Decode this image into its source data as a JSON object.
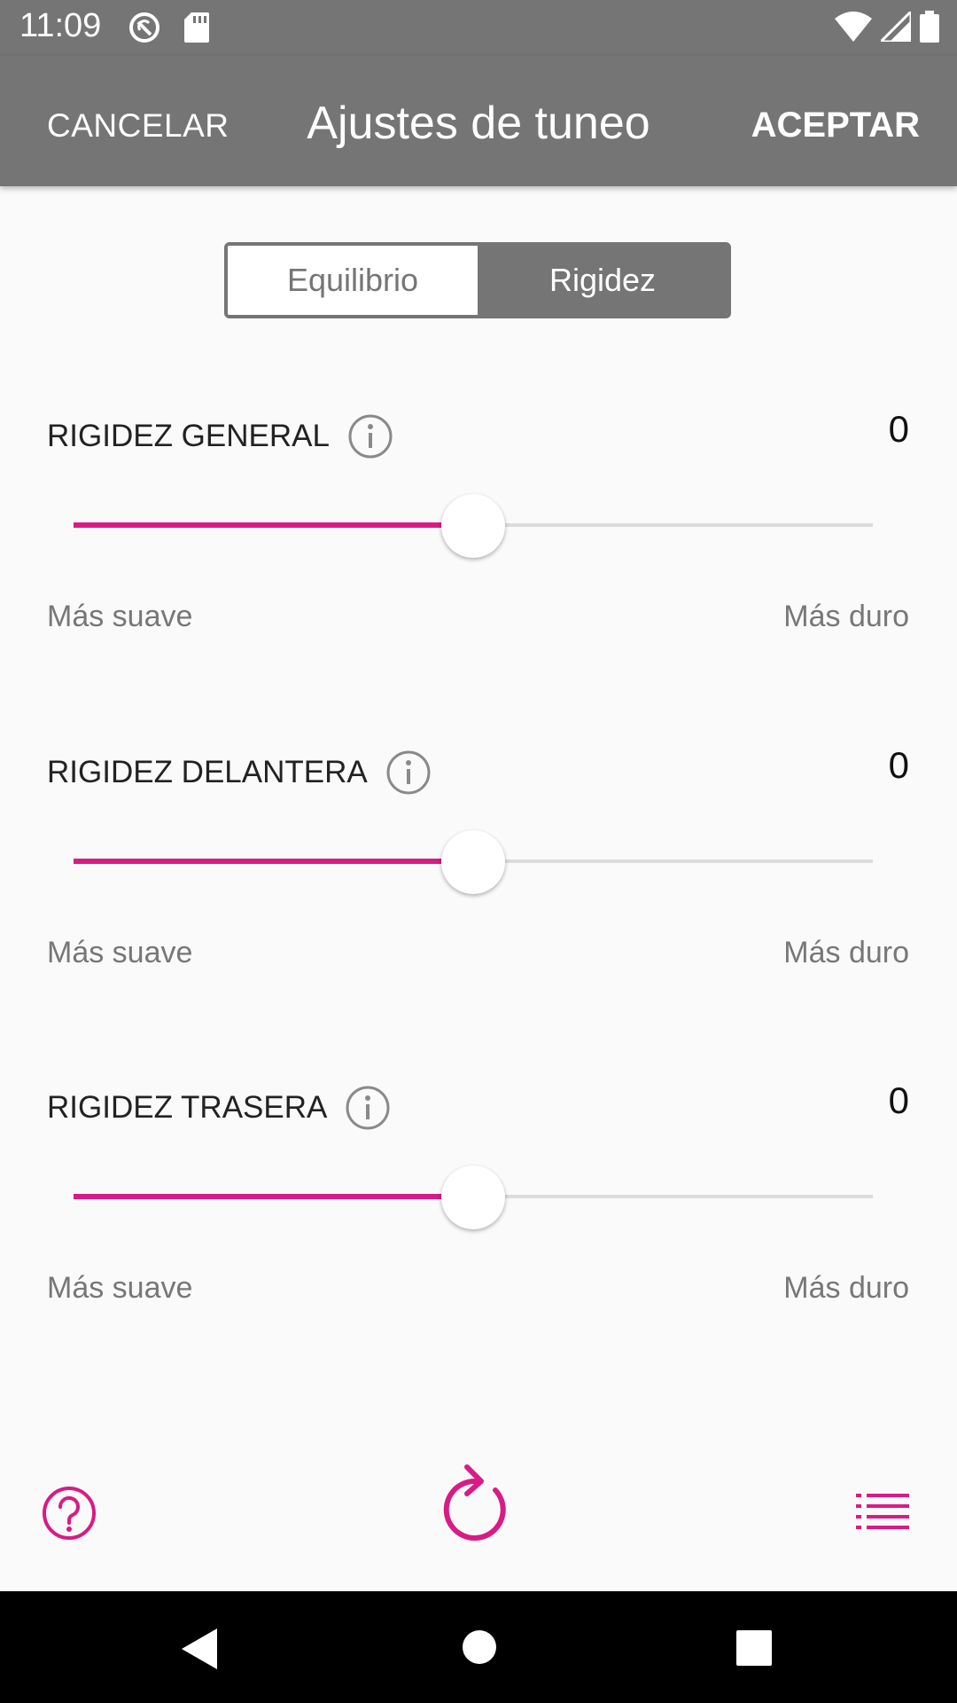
{
  "status_bar": {
    "time": "11:09",
    "icons": [
      "sync-off-icon",
      "sd-card-icon",
      "wifi-icon",
      "signal-icon",
      "battery-icon"
    ]
  },
  "app_bar": {
    "cancel_label": "CANCELAR",
    "title": "Ajustes de tuneo",
    "accept_label": "ACEPTAR"
  },
  "tabs": [
    {
      "label": "Equilibrio",
      "selected": false
    },
    {
      "label": "Rigidez",
      "selected": true
    }
  ],
  "sliders": [
    {
      "label": "RIGIDEZ GENERAL",
      "value": "0",
      "min_label": "Más suave",
      "max_label": "Más duro",
      "position": 0.5
    },
    {
      "label": "RIGIDEZ DELANTERA",
      "value": "0",
      "min_label": "Más suave",
      "max_label": "Más duro",
      "position": 0.5
    },
    {
      "label": "RIGIDEZ TRASERA",
      "value": "0",
      "min_label": "Más suave",
      "max_label": "Más duro",
      "position": 0.5
    }
  ],
  "bottom_toolbar": {
    "icons": [
      "help-icon",
      "reset-icon",
      "list-icon"
    ]
  },
  "colors": {
    "accent": "#d81b86",
    "bar": "#757575",
    "background": "#fafafa"
  }
}
